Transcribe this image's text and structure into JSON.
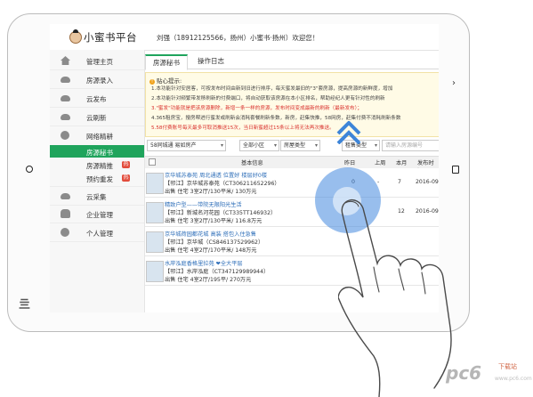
{
  "header": {
    "logo_text": "小蜜书平台",
    "user_info": "刘强（18912125566，扬州）小蜜书·扬州）欢迎您！"
  },
  "sidebar": {
    "items": [
      {
        "label": "管理主页",
        "icon": "home-icon"
      },
      {
        "label": "房源录入",
        "icon": "cloud-upload-icon"
      },
      {
        "label": "云发布",
        "icon": "cloud-upload-icon"
      },
      {
        "label": "云刷新",
        "icon": "cloud-refresh-icon"
      },
      {
        "label": "网络精耕",
        "icon": "pie-chart-icon"
      }
    ],
    "sub_items": [
      {
        "label": "房源秘书",
        "active": true
      },
      {
        "label": "房源精推",
        "badge": "热"
      },
      {
        "label": "预约重发",
        "badge": "热"
      }
    ],
    "items2": [
      {
        "label": "云采集",
        "icon": "cloud-download-icon"
      },
      {
        "label": "企业管理",
        "icon": "users-icon"
      },
      {
        "label": "个人管理",
        "icon": "user-icon"
      }
    ]
  },
  "tabs": [
    {
      "label": "房源秘书",
      "active": true
    },
    {
      "label": "操作日志",
      "active": false
    }
  ],
  "tips": {
    "title": "贴心提示:",
    "lines": [
      "1.本功能针对安居客，可按发布时间由新到旧进行排序，每天蜜发最旧的\"3\"套房源，提高房源的新鲜度，增加",
      "2.本功能针对频繁带发移刷新的付费端口，将自动获取该房源在本小区排名，帮助经纪人更有针对性的刷新",
      "3.\"蜜发\"功能就是把该房源删除，新增一条一样的房源，发布时间变成最新的刷新（最新发布）；",
      "4.365租房宝，搜房帮进行蜜发或刷新会消耗套餐刷新条数，新房，赶集快推，58网房，赶集付费不消耗刷新条数",
      "5.58付费账号每天最多可取消推送15次，当日新蜜超过15条以上将无法再次推送。"
    ]
  },
  "filters": {
    "site": "58同城通 易如房产",
    "community": "全部小区",
    "house_type": "房屋类型",
    "rent_type": "租售类型",
    "search_placeholder": "请输入房源编号"
  },
  "table": {
    "headers": {
      "basic": "基本信息",
      "yesterday": "昨日",
      "last_week": "上周",
      "this_month": "本月",
      "publish_time": "发布时间"
    },
    "rows": [
      {
        "title": "京华城苏泰苑  周北通透  位置好  楼层好0楼",
        "line2": "【邗江】京华城苏泰苑（CT306211652296）",
        "line3": "出售  住宅  3室2厅/130平米/  130万元",
        "yesterday": "0",
        "last_week": "-",
        "this_month": "7",
        "date": "2016-09"
      },
      {
        "title": "精致户型——带院无限阳光生活",
        "line2": "【邗江】新城名河花园（CT335TT146932）",
        "line3": "出售  住宅  3室2厅/130平米/  116.8万元",
        "yesterday": "",
        "last_week": "",
        "this_month": "12",
        "date": "2016-09"
      },
      {
        "title": "京华城荷园都花城  高装  搭包入住急售",
        "line2": "【邗江】京华城（CS846137529962）",
        "line3": "出售  住宅  4室2厅/170平米/  148万元",
        "yesterday": "",
        "last_week": "",
        "this_month": "",
        "date": ""
      },
      {
        "title": "水岸泓庭香格里拉苑  ❤全大平层",
        "line2": "【邗江】水岸泓庭（CT347129989944）",
        "line3": "出售  住宅  4室2厅/195平/  270万元",
        "yesterday": "",
        "last_week": "",
        "this_month": "",
        "date": ""
      }
    ]
  },
  "watermark": {
    "logo": "pc6",
    "sub": "下载站",
    "url": "www.pc6.com"
  },
  "colors": {
    "accent_green": "#1fa45c",
    "link_blue": "#2f6fb9",
    "badge_red": "#e24b3b",
    "touch_blue": "#4389de"
  }
}
